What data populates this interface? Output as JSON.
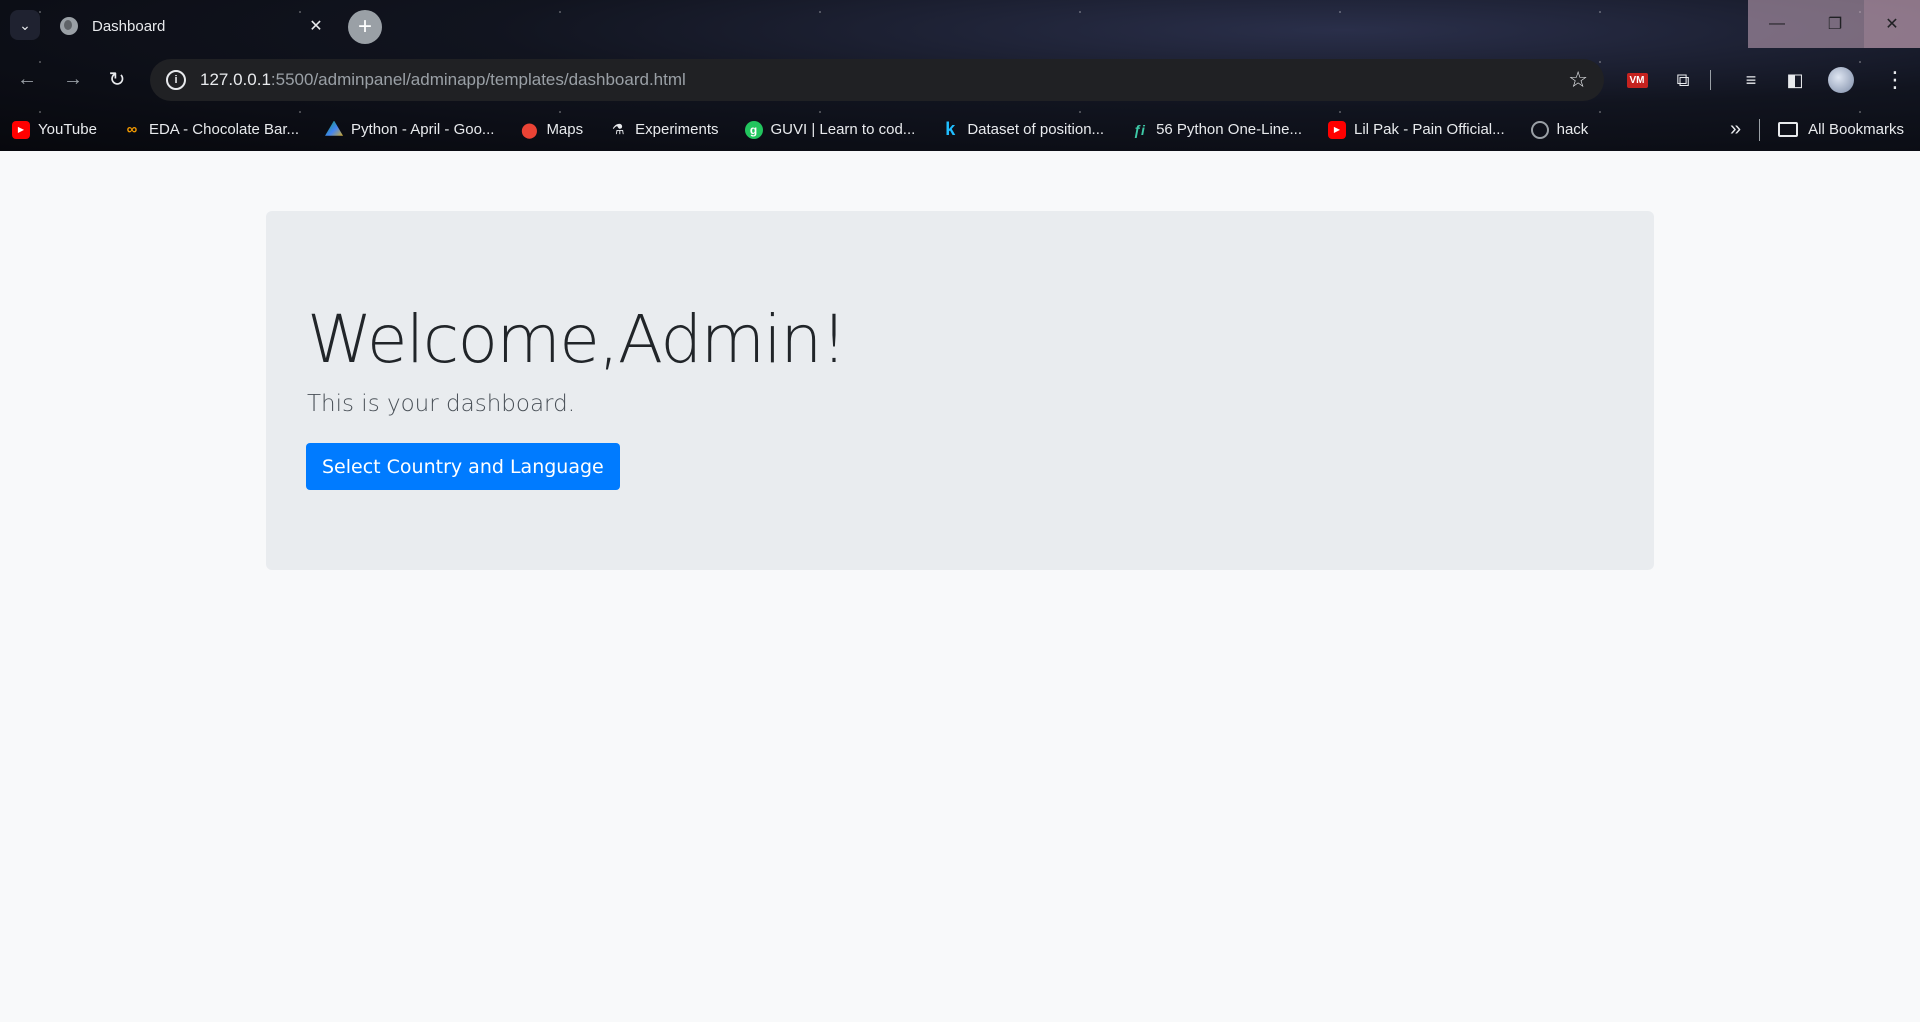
{
  "browser": {
    "tab": {
      "title": "Dashboard",
      "close": "✕"
    },
    "new_tab": "+",
    "window_controls": {
      "minimize": "—",
      "maximize": "❐",
      "close": "✕"
    },
    "nav": {
      "back": "←",
      "forward": "→",
      "reload": "↻"
    },
    "omnibox": {
      "info": "i",
      "host": "127.0.0.1",
      "path": ":5500/adminpanel/adminapp/templates/dashboard.html",
      "star": "☆"
    },
    "extensions": {
      "vm": "VM",
      "puzzle": "⧉",
      "media": "≡",
      "sidepanel": "◧",
      "menu": "⋮"
    },
    "bookmarks": [
      {
        "label": "YouTube",
        "icon": "youtube-icon"
      },
      {
        "label": "EDA - Chocolate Bar...",
        "icon": "colab-icon"
      },
      {
        "label": "Python - April - Goo...",
        "icon": "google-drive-icon"
      },
      {
        "label": "Maps",
        "icon": "maps-icon"
      },
      {
        "label": "Experiments",
        "icon": "flask-icon"
      },
      {
        "label": "GUVI | Learn to cod...",
        "icon": "guvi-icon"
      },
      {
        "label": "Dataset of position...",
        "icon": "kaggle-icon"
      },
      {
        "label": "56 Python One-Line...",
        "icon": "fi-icon"
      },
      {
        "label": "Lil Pak - Pain Official...",
        "icon": "youtube-icon"
      },
      {
        "label": "hack",
        "icon": "globe-icon"
      }
    ],
    "bookmarks_more": "»",
    "all_bookmarks": "All Bookmarks"
  },
  "page": {
    "heading": "Welcome,Admin!",
    "lead": "This is your dashboard.",
    "button_label": "Select Country and Language"
  },
  "colors": {
    "primary": "#007bff",
    "jumbotron_bg": "#e9ecef",
    "page_bg": "#f8f9fa"
  }
}
